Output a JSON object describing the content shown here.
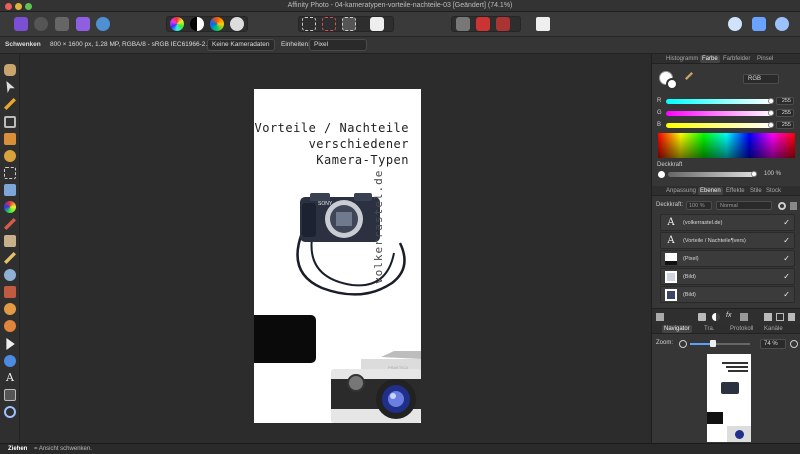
{
  "window": {
    "title": "Affinity Photo - 04-kameratypen-vorteile-nachteile-03 [Geändert] (74.1%)"
  },
  "context": {
    "tool_name": "Schwenken",
    "doc_info": "800 × 1600 px, 1.28 MP, RGBA/8 - sRGB IEC61966-2.1",
    "camera_button": "Keine Kameradaten",
    "units_label": "Einheiten:",
    "units_value": "Pixel"
  },
  "document": {
    "title_lines": [
      "Vorteile / Nachteile",
      "verschiedener",
      "Kamera-Typen"
    ],
    "url_text": "volkerrastel.de",
    "camera_brand": "SONY",
    "camera_brand_2": "PRAKTICA"
  },
  "panels": {
    "top_tabs": [
      "Histogramm",
      "Farbe",
      "Farbfelder",
      "Pinsel"
    ],
    "active_top_tab": "Farbe",
    "color_model": "RGB",
    "channels": [
      {
        "label": "R",
        "value": "255",
        "color": "#e0443a"
      },
      {
        "label": "G",
        "value": "255",
        "color": "#43c24b"
      },
      {
        "label": "B",
        "value": "255",
        "color": "#3b6ee6"
      }
    ],
    "opacity_label": "Deckkraft",
    "opacity_value": "100 %",
    "mid_tabs": [
      "Anpassung",
      "Ebenen",
      "Effekte",
      "Stile",
      "Stock"
    ],
    "active_mid_tab": "Ebenen",
    "layers_opacity_label": "Deckkraft:",
    "layers_opacity_value": "100 %",
    "blend_mode": "Normal",
    "layers": [
      {
        "icon": "A",
        "name": "(volkerrastel.de)"
      },
      {
        "icon": "A",
        "name": "(Vorteile / Nachteile¶vers)"
      },
      {
        "icon": "",
        "name": "(Pixel)"
      },
      {
        "icon": "",
        "name": "(Bild)"
      },
      {
        "icon": "",
        "name": "(Bild)"
      }
    ],
    "bottom_tabs": [
      "Navigator",
      "Tra.",
      "Protokoll",
      "Kanäle"
    ],
    "active_bottom_tab": "Navigator",
    "zoom_label": "Zoom:",
    "zoom_value": "74 %"
  },
  "status": {
    "action": "Ziehen",
    "hint": "= Ansicht schwenken."
  }
}
